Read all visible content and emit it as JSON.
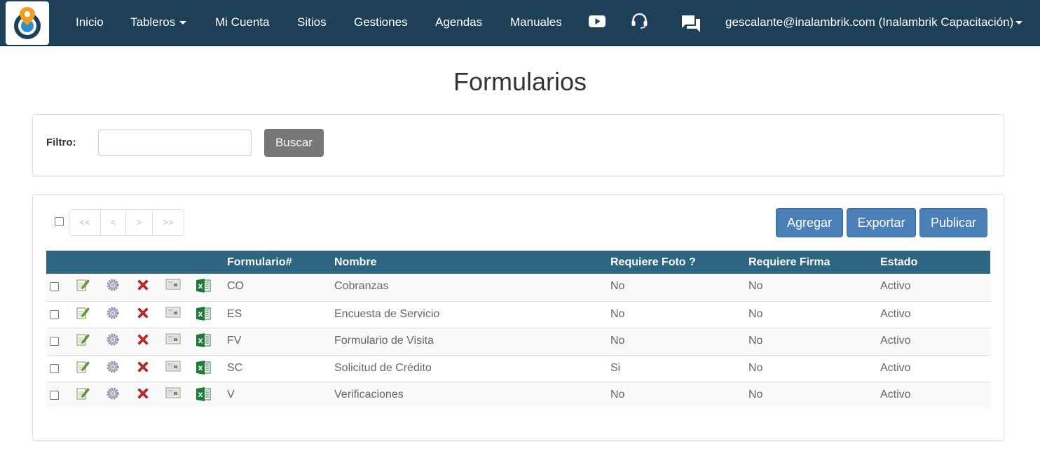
{
  "navbar": {
    "items": [
      {
        "label": "Inicio"
      },
      {
        "label": "Tableros"
      },
      {
        "label": "Mi Cuenta"
      },
      {
        "label": "Sitios"
      },
      {
        "label": "Gestiones"
      },
      {
        "label": "Agendas"
      },
      {
        "label": "Manuales"
      }
    ],
    "icons": [
      "youtube-icon",
      "headset-icon",
      "chat-icon"
    ],
    "user_label": "gescalante@inalambrik.com (Inalambrik Capacitación)"
  },
  "page": {
    "title": "Formularios"
  },
  "filter": {
    "label": "Filtro:",
    "value": "",
    "search_button": "Buscar"
  },
  "toolbar": {
    "pager": [
      "<<",
      "<",
      ">",
      ">>"
    ],
    "add_button": "Agregar",
    "export_button": "Exportar",
    "publish_button": "Publicar"
  },
  "table": {
    "columns": [
      "Formulario#",
      "Nombre",
      "Requiere Foto ?",
      "Requiere Firma",
      "Estado"
    ],
    "row_actions": [
      "edit-icon",
      "settings-icon",
      "delete-icon",
      "preview-icon",
      "excel-icon"
    ],
    "rows": [
      {
        "code": "CO",
        "name": "Cobranzas",
        "foto": "No",
        "firma": "No",
        "estado": "Activo"
      },
      {
        "code": "ES",
        "name": "Encuesta de Servicio",
        "foto": "No",
        "firma": "No",
        "estado": "Activo"
      },
      {
        "code": "FV",
        "name": "Formulario de Visita",
        "foto": "No",
        "firma": "No",
        "estado": "Activo"
      },
      {
        "code": "SC",
        "name": "Solicitud de Crédito",
        "foto": "Si",
        "firma": "No",
        "estado": "Activo"
      },
      {
        "code": "V",
        "name": "Verificaciones",
        "foto": "No",
        "firma": "No",
        "estado": "Activo"
      }
    ]
  },
  "colors": {
    "navbar": "#1d3f57",
    "table_header": "#2e6682",
    "primary_button": "#4a7fb8",
    "search_button": "#777777"
  }
}
